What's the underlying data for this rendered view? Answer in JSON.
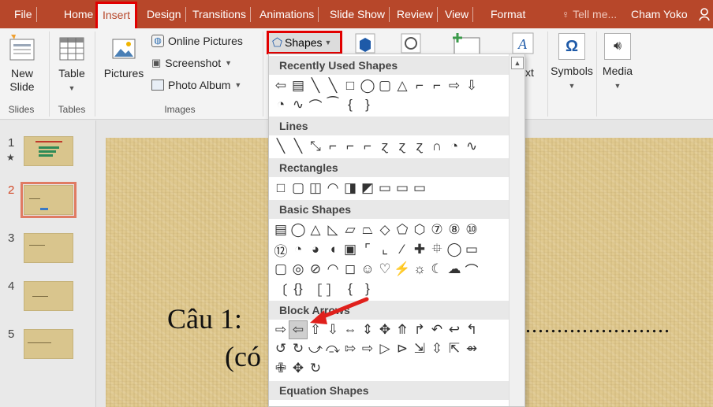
{
  "tabs": [
    "File",
    "Home",
    "Insert",
    "Design",
    "Transitions",
    "Animations",
    "Slide Show",
    "Review",
    "View",
    "Format"
  ],
  "active_tab": "Insert",
  "tell_me": "Tell me...",
  "user_name": "Cham Yoko",
  "ribbon": {
    "new_slide": "New Slide",
    "table": "Table",
    "pictures": "Pictures",
    "online_pictures": "Online Pictures",
    "screenshot": "Screenshot",
    "photo_album": "Photo Album",
    "shapes": "Shapes",
    "text_partial": "xt",
    "symbols": "Symbols",
    "media": "Media",
    "groups": {
      "slides": "Slides",
      "tables": "Tables",
      "images": "Images"
    }
  },
  "dropdown": {
    "sections": [
      {
        "title": "Recently Used Shapes",
        "rows": [
          [
            "⇦",
            "▤",
            "╲",
            "╲",
            "□",
            "◯",
            "▢",
            "△",
            "⌐",
            "⌐",
            "⇨",
            "⇩"
          ],
          [
            "◔",
            "∿",
            "⌒",
            "⁀",
            "{",
            "}"
          ]
        ]
      },
      {
        "title": "Lines",
        "rows": [
          [
            "╲",
            "╲",
            "⤡",
            "⌐",
            "⌐",
            "⌐",
            "ɀ",
            "ɀ",
            "ɀ",
            "∩",
            "◔",
            "∿"
          ]
        ]
      },
      {
        "title": "Rectangles",
        "rows": [
          [
            "□",
            "▢",
            "◫",
            "◠",
            "◨",
            "◩",
            "▭",
            "▭",
            "▭"
          ]
        ]
      },
      {
        "title": "Basic Shapes",
        "rows": [
          [
            "▤",
            "◯",
            "△",
            "◺",
            "▱",
            "⏢",
            "◇",
            "⬠",
            "⬡",
            "⑦",
            "⑧",
            "⑩"
          ],
          [
            "⑫",
            "◔",
            "◕",
            "◖",
            "▣",
            "⌜",
            "⌞",
            "⁄",
            "✚",
            "⯐",
            "◯",
            "▭"
          ],
          [
            "▢",
            "◎",
            "⊘",
            "◠",
            "◻",
            "☺",
            "♡",
            "⚡",
            "☼",
            "☾",
            "☁",
            "⌒"
          ],
          [
            "〔",
            "{}",
            "［",
            "］",
            "{",
            "}"
          ]
        ]
      },
      {
        "title": "Block Arrows",
        "rows": [
          [
            "⇨",
            "⇦",
            "⇧",
            "⇩",
            "⇔",
            "⇕",
            "✥",
            "⤊",
            "↱",
            "↶",
            "↩",
            "↰"
          ],
          [
            "↺",
            "↻",
            "⤻",
            "⤼",
            "⇰",
            "⇨",
            "▷",
            "⊳",
            "⇲",
            "⇳",
            "⇱",
            "⇴"
          ],
          [
            "✙",
            "✥",
            "↻"
          ]
        ]
      },
      {
        "title": "Equation Shapes",
        "rows": []
      }
    ]
  },
  "slides": [
    "1",
    "2",
    "3",
    "4",
    "5"
  ],
  "selected_slide": "2",
  "slide_text": {
    "line1": "Câu 1:",
    "line2": "(có",
    "dots": "......................."
  },
  "colors": {
    "accent": "#b7472a",
    "highlight": "#e20000"
  }
}
